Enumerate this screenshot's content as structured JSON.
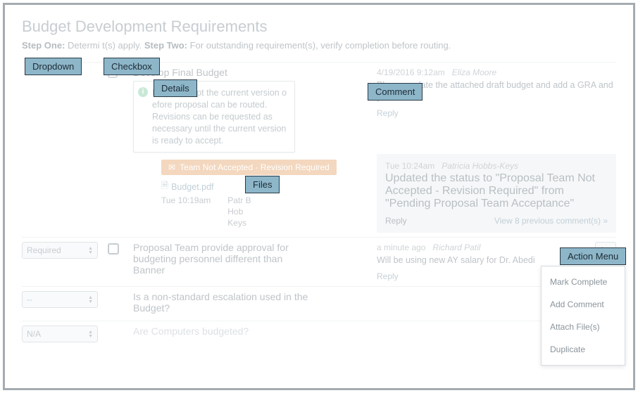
{
  "header": {
    "title": "Budget Development Requirements",
    "step1_label": "Step One:",
    "step1_text": " Determi                              t(s) apply. ",
    "step2_label": "Step Two:",
    "step2_text": " For outstanding requirement(s), verify completion before routing."
  },
  "rows": [
    {
      "dropdown": "",
      "title": "Develop Final Budget",
      "details": "Proposa                        cept the current version o                    efore proposal can be routed. Revisions can be requested as necessary until the current version is ready to accept.",
      "badge": "Team Not Accepted - Revision Required",
      "file": {
        "name": "Budget.pdf",
        "time": "Tue 10:19am",
        "uploader": "Patr                B\nHob\nKeys"
      },
      "comments": [
        {
          "meta_time": "4/19/2016 9:12am",
          "meta_user": "Eliza Moore",
          "body": "Please update the attached draft budget and add a GRA and yo",
          "reply": "Reply"
        }
      ],
      "status_comment": {
        "meta_time": "Tue 10:24am",
        "meta_user": "Patricia Hobbs-Keys",
        "body": "Updated the status to \"Proposal Team Not Accepted - Revision Required\" from \"Pending Proposal Team Acceptance\"",
        "reply": "Reply",
        "view_prev": "View 8 previous comment(s) »"
      }
    },
    {
      "dropdown": "Required",
      "title": "Proposal Team provide approval for budgeting personnel different than Banner",
      "comments": [
        {
          "meta_time": "a minute ago",
          "meta_user": "Richard Patil",
          "body": "Will be using new AY salary for Dr. Abedi",
          "reply": "Reply"
        }
      ]
    },
    {
      "dropdown": "--",
      "title": "Is a non-standard escalation used in the Budget?"
    },
    {
      "dropdown": "N/A",
      "title": "Are Computers budgeted?"
    }
  ],
  "action_menu": {
    "items": [
      "Mark Complete",
      "Add Comment",
      "Attach File(s)",
      "Duplicate"
    ]
  },
  "callouts": {
    "dropdown": "Dropdown",
    "checkbox": "Checkbox",
    "details": "Details",
    "comment": "Comment",
    "files": "Files",
    "action_menu": "Action Menu"
  }
}
